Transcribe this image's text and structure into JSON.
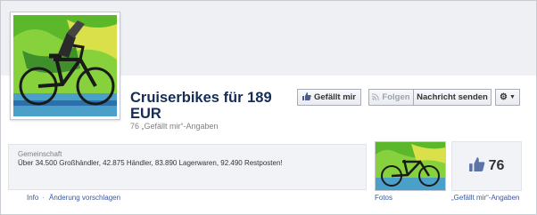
{
  "page": {
    "title": "Cruiserbikes für 189 EUR",
    "likes_line": "76 „Gefällt mir“-Angaben"
  },
  "buttons": {
    "like": "Gefällt mir",
    "follow": "Folgen",
    "message": "Nachricht senden",
    "settings_icon": "gear-icon"
  },
  "about": {
    "category": "Gemeinschaft",
    "text": "Über 34.500 Großhändler, 42.875 Händler, 83.890 Lagerwaren, 92.490 Restposten!"
  },
  "stats": {
    "like_count": "76"
  },
  "links": {
    "info": "Info",
    "separator": "·",
    "edit": "Änderung vorschlagen",
    "photos": "Fotos",
    "likes": "„Gefällt mir“-Angaben"
  },
  "colors": {
    "title": "#152c54",
    "link": "#3b5998",
    "bike_green": "#8cd43a"
  }
}
